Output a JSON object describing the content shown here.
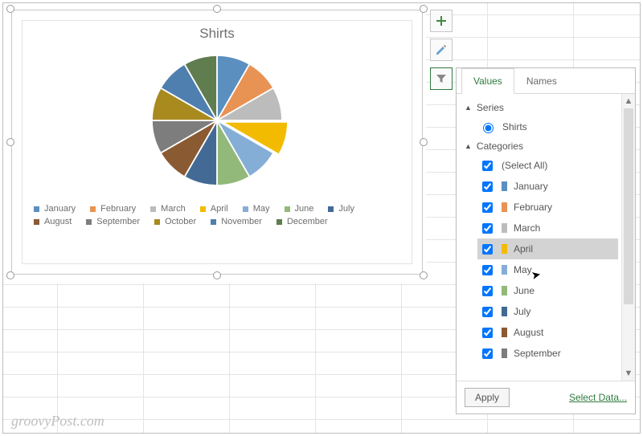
{
  "chart_data": {
    "type": "pie",
    "title": "Shirts",
    "categories": [
      "January",
      "February",
      "March",
      "April",
      "May",
      "June",
      "July",
      "August",
      "September",
      "October",
      "November",
      "December"
    ],
    "series": [
      {
        "name": "Shirts",
        "values": [
          8.3,
          8.3,
          8.3,
          8.3,
          8.3,
          8.3,
          8.3,
          8.3,
          8.3,
          8.3,
          8.3,
          8.3
        ]
      }
    ],
    "colors": [
      "#5b8fbf",
      "#e89254",
      "#bcbcbc",
      "#f2bb00",
      "#85aed6",
      "#93b97a",
      "#436a94",
      "#8a5a33",
      "#7d7d7d",
      "#a88a1e",
      "#4f7fae",
      "#5f7d4f"
    ],
    "legend_position": "bottom"
  },
  "float_buttons": {
    "plus_tip": "Add Chart Element",
    "brush_tip": "Chart Styles",
    "filter_tip": "Chart Filters"
  },
  "panel": {
    "tabs": {
      "values": "Values",
      "names": "Names"
    },
    "series_label": "Series",
    "series_items": [
      "Shirts"
    ],
    "categories_label": "Categories",
    "select_all": "(Select All)",
    "hovered": "April",
    "visible_months": [
      "January",
      "February",
      "March",
      "April",
      "May",
      "June",
      "July",
      "August",
      "September"
    ],
    "apply": "Apply",
    "select_data": "Select Data..."
  },
  "watermark": "groovyPost.com"
}
